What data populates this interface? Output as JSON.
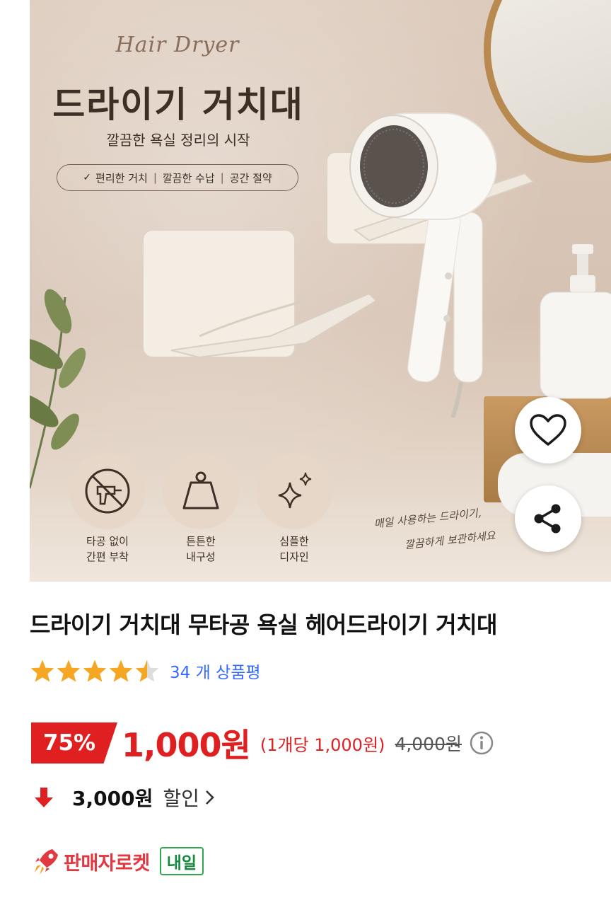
{
  "hero": {
    "script_title": "Hair Dryer",
    "main_title": "드라이기 거치대",
    "subtitle": "깔끔한 욕실 정리의 시작",
    "features": [
      "편리한 거치",
      "깔끔한 수납",
      "공간 절약"
    ],
    "feature_icons": [
      {
        "icon": "no-drill-icon",
        "line1": "타공 없이",
        "line2": "간편 부착"
      },
      {
        "icon": "weight-icon",
        "line1": "튼튼한",
        "line2": "내구성"
      },
      {
        "icon": "sparkle-icon",
        "line1": "심플한",
        "line2": "디자인"
      }
    ],
    "hand_note_line1": "매일 사용하는 드라이기,",
    "hand_note_line2": "깔끔하게 보관하세요"
  },
  "actions": {
    "wishlist_icon": "heart-icon",
    "share_icon": "share-icon"
  },
  "product": {
    "title": "드라이기 거치대 무타공 욕실 헤어드라이기 거치대",
    "rating": 4.5,
    "rating_max": 5,
    "review_text": "34 개 상품평"
  },
  "price": {
    "discount_rate": "75%",
    "sale_price": "1,000원",
    "unit_price": "(1개당 1,000원)",
    "original_price": "4,000원"
  },
  "coupon": {
    "amount": "3,000원",
    "label": "할인"
  },
  "delivery": {
    "rocket_label": "판매자로켓",
    "badge": "내일"
  },
  "colors": {
    "accent_red": "#e02020",
    "link_blue": "#346aff",
    "star": "#f5a623",
    "tomorrow_green": "#2fa84f"
  }
}
